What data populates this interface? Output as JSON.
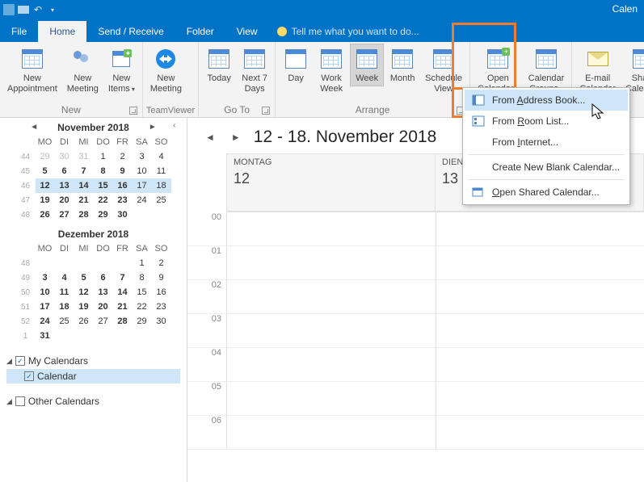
{
  "titlebar": {
    "appTitle": "Calen"
  },
  "tabs": {
    "file": "File",
    "home": "Home",
    "sendreceive": "Send / Receive",
    "folder": "Folder",
    "view": "View",
    "tellme": "Tell me what you want to do..."
  },
  "ribbon": {
    "new": {
      "appointment": "New\nAppointment",
      "meeting": "New\nMeeting",
      "items": "New\nItems",
      "group": "New"
    },
    "teamviewer": {
      "meeting": "New\nMeeting",
      "group": "TeamViewer"
    },
    "goto": {
      "today": "Today",
      "next7": "Next 7\nDays",
      "group": "Go To"
    },
    "arrange": {
      "day": "Day",
      "workweek": "Work\nWeek",
      "week": "Week",
      "month": "Month",
      "schedule": "Schedule\nView",
      "group": "Arrange"
    },
    "manage": {
      "open": "Open\nCalendar",
      "groups": "Calendar\nGroups"
    },
    "share": {
      "email": "E-mail\nCalendar",
      "share": "Share\nCalendar"
    }
  },
  "menu": {
    "addressbook": "From Address Book...",
    "addressbook_u": "A",
    "roomlist": "From Room List...",
    "roomlist_u": "R",
    "internet": "From Internet...",
    "internet_u": "I",
    "createblank": "Create New Blank Calendar...",
    "openshared": "Open Shared Calendar...",
    "openshared_u": "O"
  },
  "sidebar": {
    "cal1": {
      "title": "November 2018",
      "dow": [
        "MO",
        "DI",
        "MI",
        "DO",
        "FR",
        "SA",
        "SO"
      ],
      "weeks": [
        {
          "wk": "44",
          "days": [
            "29",
            "30",
            "31",
            "1",
            "2",
            "3",
            "4"
          ],
          "mute": [
            0,
            1,
            2
          ]
        },
        {
          "wk": "45",
          "days": [
            "5",
            "6",
            "7",
            "8",
            "9",
            "10",
            "11"
          ],
          "bold": [
            0,
            1,
            2,
            3,
            4
          ]
        },
        {
          "wk": "46",
          "days": [
            "12",
            "13",
            "14",
            "15",
            "16",
            "17",
            "18"
          ],
          "selRange": true,
          "selDay": 3,
          "bold": [
            0,
            1,
            2,
            3,
            4
          ]
        },
        {
          "wk": "47",
          "days": [
            "19",
            "20",
            "21",
            "22",
            "23",
            "24",
            "25"
          ],
          "bold": [
            0,
            1,
            2,
            3,
            4
          ]
        },
        {
          "wk": "48",
          "days": [
            "26",
            "27",
            "28",
            "29",
            "30"
          ],
          "bold": [
            0,
            1,
            2,
            3,
            4
          ]
        }
      ]
    },
    "cal2": {
      "title": "Dezember 2018",
      "dow": [
        "MO",
        "DI",
        "MI",
        "DO",
        "FR",
        "SA",
        "SO"
      ],
      "weeks": [
        {
          "wk": "48",
          "days": [
            "",
            "",
            "",
            "",
            "",
            "1",
            "2"
          ]
        },
        {
          "wk": "49",
          "days": [
            "3",
            "4",
            "5",
            "6",
            "7",
            "8",
            "9"
          ],
          "bold": [
            0,
            1,
            2,
            3,
            4
          ]
        },
        {
          "wk": "50",
          "days": [
            "10",
            "11",
            "12",
            "13",
            "14",
            "15",
            "16"
          ],
          "bold": [
            0,
            1,
            2,
            3,
            4
          ]
        },
        {
          "wk": "51",
          "days": [
            "17",
            "18",
            "19",
            "20",
            "21",
            "22",
            "23"
          ],
          "bold": [
            0,
            1,
            2,
            3,
            4
          ]
        },
        {
          "wk": "52",
          "days": [
            "24",
            "25",
            "26",
            "27",
            "28",
            "29",
            "30"
          ],
          "bold": [
            0,
            4
          ]
        },
        {
          "wk": "1",
          "days": [
            "31"
          ],
          "bold": [
            0
          ]
        }
      ]
    },
    "tree": {
      "mycals": "My Calendars",
      "calendar": "Calendar",
      "othercals": "Other Calendars"
    }
  },
  "main": {
    "range": "12 - 18. November 2018",
    "days": [
      {
        "name": "MONTAG",
        "num": "12"
      },
      {
        "name": "DIENSTAG",
        "num": "13"
      }
    ],
    "times": [
      "00",
      "01",
      "02",
      "03",
      "04",
      "05",
      "06"
    ]
  }
}
